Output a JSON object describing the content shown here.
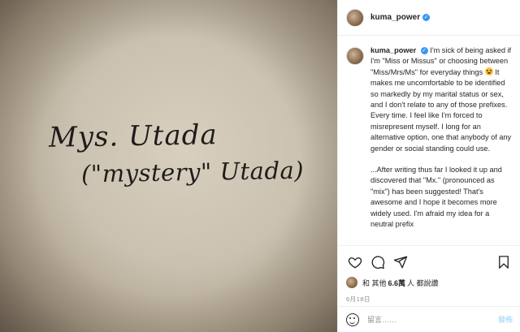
{
  "photo": {
    "handwriting_line1": "Mys. Utada",
    "handwriting_line2": "(\"mystery\" Utada)"
  },
  "header": {
    "username": "kuma_power",
    "verified_icon": "verified-badge-icon"
  },
  "caption": {
    "username": "kuma_power",
    "paragraph1_a": "I'm sick of being asked if I'm \"Miss or Missus\" or choosing between \"Miss/Mrs/Ms\" for everyday things",
    "paragraph1_b": " It makes me uncomfortable to be identified so markedly by my marital status or sex, and I don't relate to any of those prefixes. Every time. I feel like I'm forced to misrepresent myself. I long for an alternative option, one that anybody of any gender or social standing could use.",
    "paragraph2": "...After writing thus far I looked it up and discovered that \"Mx.\" (pronounced as \"mix\") has been suggested! That's awesome and I hope it becomes more widely used. I'm afraid my idea for a neutral prefix"
  },
  "actions": {
    "like_icon": "heart-icon",
    "comment_icon": "comment-icon",
    "share_icon": "paper-plane-icon",
    "save_icon": "bookmark-icon"
  },
  "likes": {
    "prefix": "和 其他",
    "count": "6.6萬",
    "suffix": "人 都說讚"
  },
  "date": "6月18日",
  "comment": {
    "placeholder": "留言……",
    "post_label": "發佈"
  },
  "colors": {
    "verified": "#3897f0",
    "post_button": "#b2dffc",
    "muted_text": "#8e8e8e",
    "border": "#efefef"
  }
}
